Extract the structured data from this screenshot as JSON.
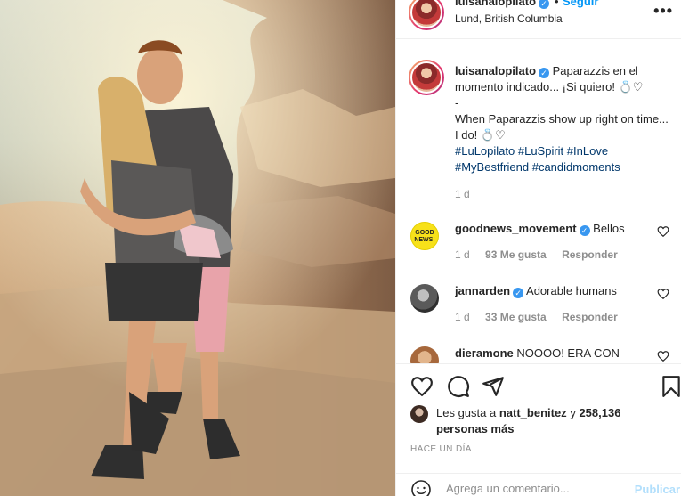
{
  "post": {
    "username": "luisanalopilato",
    "follow_label": "Seguir",
    "separator": "•",
    "location": "Lund, British Columbia",
    "more_label": "•••"
  },
  "caption": {
    "username": "luisanalopilato",
    "text_es": "Paparazzis en el momento indicado... ¡Si quiero!",
    "separator": "-",
    "text_en": "When Paparazzis show up right on time... I do!",
    "emoji_ring": "💍",
    "emoji_heart": "♡",
    "hashtags": [
      "#LuLopilato",
      "#LuSpirit",
      "#InLove",
      "#MyBestfriend",
      "#candidmoments"
    ],
    "time": "1 d"
  },
  "comments": [
    {
      "username": "goodnews_movement",
      "verified": true,
      "text": "Bellos",
      "time": "1 d",
      "likes": "93 Me gusta",
      "reply": "Responder",
      "avatar_text": "GOOD NEWS!"
    },
    {
      "username": "jannarden",
      "verified": true,
      "text": "Adorable humans",
      "time": "1 d",
      "likes": "33 Me gusta",
      "reply": "Responder"
    },
    {
      "username": "dieramone",
      "verified": false,
      "text": "NOOOO! ERA CON",
      "time": "",
      "likes": "",
      "reply": ""
    }
  ],
  "actions": {
    "liked_by_prefix": "Les gusta a",
    "liked_by_user": "natt_benitez",
    "liked_by_and": "y",
    "liked_by_count": "258,136 personas más",
    "time_ago": "HACE UN DÍA"
  },
  "comment_box": {
    "placeholder": "Agrega un comentario...",
    "publish_label": "Publicar"
  },
  "colors": {
    "accent": "#0095f6",
    "hashtag": "#00376b",
    "muted": "#8e8e8e",
    "verified": "#3897f0",
    "publish_disabled": "#b2dffc"
  }
}
